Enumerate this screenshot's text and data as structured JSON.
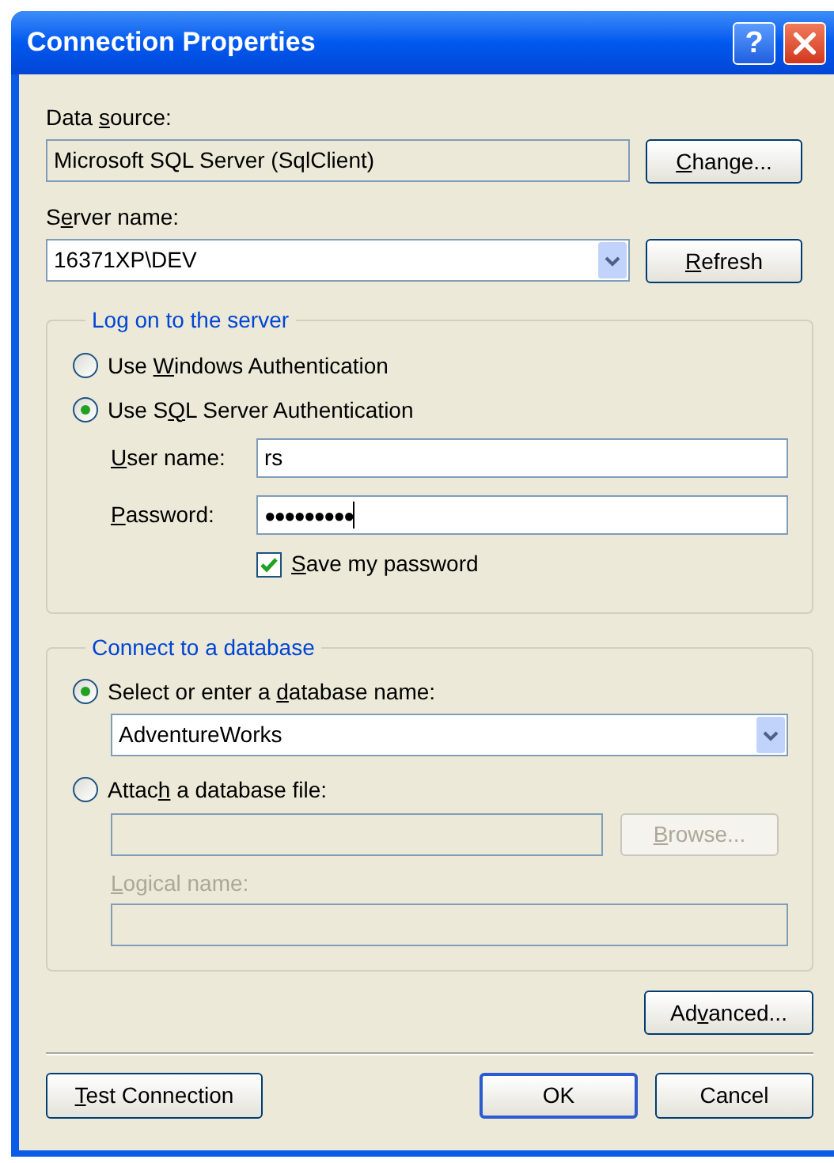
{
  "window": {
    "title": "Connection Properties",
    "help_button": "?"
  },
  "data_source": {
    "label": {
      "before": "Data ",
      "key": "s",
      "after": "ource:"
    },
    "value": "Microsoft SQL Server (SqlClient)",
    "button": {
      "key": "C",
      "after": "hange..."
    }
  },
  "server_name": {
    "label": {
      "before": "S",
      "key": "e",
      "after": "rver name:"
    },
    "value": "16371XP\\DEV",
    "button": {
      "key": "R",
      "after": "efresh"
    }
  },
  "log_on": {
    "title": "Log on to the server",
    "options": [
      {
        "label": {
          "before": "Use ",
          "key": "W",
          "after": "indows Authentication"
        },
        "selected": false
      },
      {
        "label": {
          "before": "Use S",
          "key": "Q",
          "after": "L Server Authentication"
        },
        "selected": true
      }
    ],
    "user_name": {
      "label": {
        "key": "U",
        "after": "ser name:"
      },
      "value": "rs"
    },
    "password": {
      "label": {
        "key": "P",
        "after": "assword:"
      },
      "value": "●●●●●●●●●"
    },
    "save_password": {
      "label": {
        "key": "S",
        "after": "ave my password"
      },
      "checked": true
    }
  },
  "database": {
    "title": "Connect to a database",
    "options": [
      {
        "label": {
          "before": "Select or enter a ",
          "key": "d",
          "after": "atabase name:"
        },
        "selected": true,
        "value": "AdventureWorks"
      },
      {
        "label": {
          "before": "Attac",
          "key": "h",
          "after": " a database file:"
        },
        "selected": false
      }
    ],
    "browse_button": {
      "label": {
        "key": "B",
        "after": "rowse..."
      },
      "disabled": true
    },
    "logical_name": {
      "label": {
        "key": "L",
        "after": "ogical name:"
      },
      "disabled": true
    }
  },
  "buttons": [
    {
      "kind": "advanced",
      "label": {
        "before": "Ad",
        "key": "v",
        "after": "anced..."
      }
    },
    {
      "kind": "test",
      "label": {
        "key": "T",
        "after": "est Connection"
      }
    },
    {
      "kind": "ok",
      "label": "OK"
    },
    {
      "kind": "cancel",
      "label": "Cancel"
    }
  ]
}
